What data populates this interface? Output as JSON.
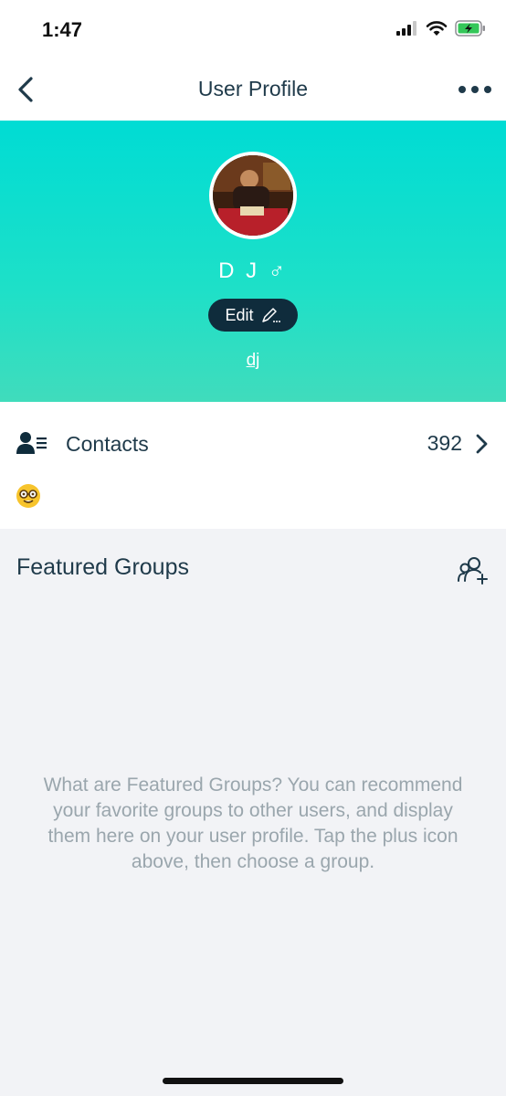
{
  "status_bar": {
    "time": "1:47"
  },
  "nav": {
    "title": "User Profile"
  },
  "profile": {
    "name": "D J",
    "gender_symbol": "♂",
    "edit_label": "Edit",
    "handle": "dj"
  },
  "contacts": {
    "label": "Contacts",
    "count": "392"
  },
  "featured_groups": {
    "title": "Featured Groups",
    "description": "What are Featured Groups? You can recommend your favorite groups to other users, and display them here on your user profile. Tap the plus icon above, then choose a group."
  },
  "colors": {
    "hero_top": "#00dcd4",
    "hero_bottom": "#40dcbc",
    "edit_button": "#0f2c3c",
    "text_primary": "#1f3a4a",
    "text_muted": "#9aa6ad",
    "battery": "#34c759"
  },
  "icons": [
    "back-chevron-icon",
    "more-dots-icon",
    "contacts-icon",
    "chevron-right-icon",
    "nerd-face-emoji-icon",
    "add-group-icon",
    "pencil-icon",
    "signal-icon",
    "wifi-icon",
    "battery-charging-icon"
  ]
}
